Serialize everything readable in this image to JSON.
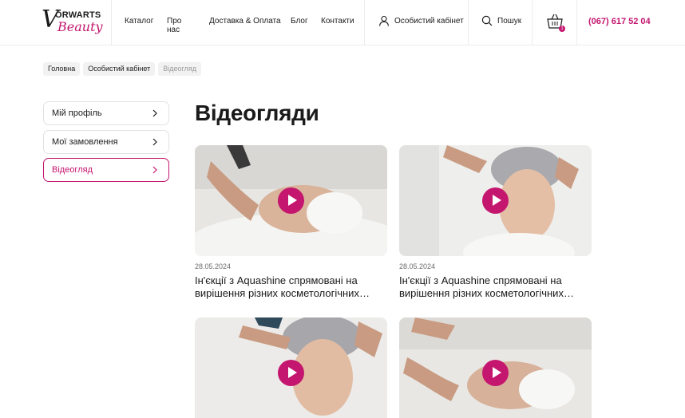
{
  "brand": {
    "logo_letter": "V",
    "logo_top": "ORWARTS",
    "logo_bottom": "Beauty"
  },
  "nav": {
    "items": [
      "Каталог",
      "Про нас",
      "Доставка & Оплата",
      "Блог",
      "Контакти"
    ],
    "cabinet_label": "Особистий кабінет",
    "search_label": "Пошук",
    "cart_count": "1",
    "phone": "(067) 617 52 04"
  },
  "breadcrumb": [
    "Головна",
    "Особистий кабінет",
    "Відеогляд"
  ],
  "sidebar": {
    "items": [
      {
        "label": "Мій профіль",
        "active": false
      },
      {
        "label": "Мої замовлення",
        "active": false
      },
      {
        "label": "Відеогляд",
        "active": true
      }
    ]
  },
  "main": {
    "title": "Відеогляди",
    "videos": [
      {
        "date": "28.05.2024",
        "title": "Ін'єкції з Aquashine спрямовані на вирішення різних косметологічних завдань"
      },
      {
        "date": "28.05.2024",
        "title": "Ін'єкції з Aquashine спрямовані на вирішення різних косметологічних завдань"
      },
      {
        "date": "",
        "title": ""
      },
      {
        "date": "",
        "title": ""
      }
    ]
  },
  "colors": {
    "accent": "#c4166f",
    "border": "#e2e2e2",
    "crumb_bg": "#f2f2f2"
  }
}
